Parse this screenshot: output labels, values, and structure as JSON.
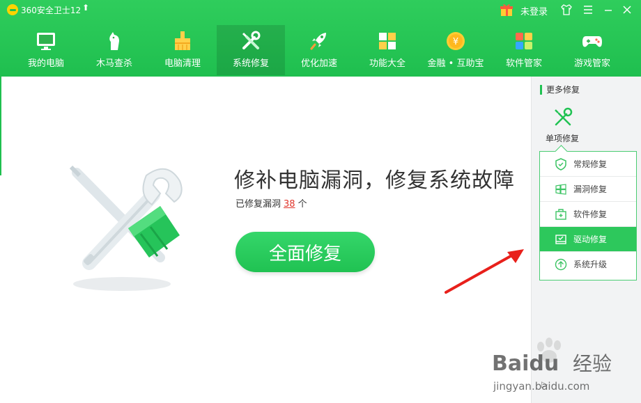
{
  "app": {
    "title": "360安全卫士12",
    "login_label": "未登录"
  },
  "nav": {
    "items": [
      {
        "label": "我的电脑",
        "icon": "monitor-icon"
      },
      {
        "label": "木马查杀",
        "icon": "horse-icon"
      },
      {
        "label": "电脑清理",
        "icon": "broom-icon"
      },
      {
        "label": "系统修复",
        "icon": "wrench-icon",
        "active": true
      },
      {
        "label": "优化加速",
        "icon": "rocket-icon"
      },
      {
        "label": "功能大全",
        "icon": "grid-icon"
      },
      {
        "label": "金融 • 互助宝",
        "icon": "coin-icon"
      },
      {
        "label": "软件管家",
        "icon": "software-icon"
      },
      {
        "label": "游戏管家",
        "icon": "gamepad-icon"
      }
    ]
  },
  "main": {
    "headline": "修补电脑漏洞，修复系统故障",
    "sub_prefix": "已修复漏洞",
    "sub_count": "38",
    "sub_suffix": "个",
    "repair_button": "全面修复"
  },
  "panel": {
    "more_title": "更多修复",
    "single_label": "单项修复",
    "menu": [
      {
        "label": "常规修复",
        "icon": "shield-icon"
      },
      {
        "label": "漏洞修复",
        "icon": "windows-icon"
      },
      {
        "label": "软件修复",
        "icon": "package-icon"
      },
      {
        "label": "驱动修复",
        "icon": "driver-icon",
        "active": true
      },
      {
        "label": "系统升级",
        "icon": "upgrade-icon"
      }
    ]
  },
  "watermark": {
    "brand": "Baidu",
    "brand_cn": "经验",
    "url": "jingyan.baidu.com"
  },
  "colors": {
    "brand_green": "#1fbf4f",
    "button_green": "#20c252",
    "count_red": "#e0352b",
    "annotation_red": "#e8201b"
  }
}
